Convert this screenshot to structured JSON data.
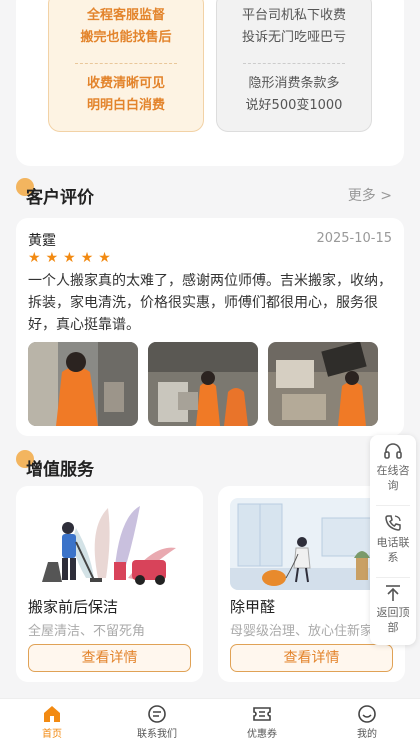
{
  "compare": {
    "good_1": "全程客服监督",
    "good_2": "搬完也能找售后",
    "good_3": "收费清晰可见",
    "good_4": "明明白白消费",
    "bad_1": "平台司机私下收费",
    "bad_2": "投诉无门吃哑巴亏",
    "bad_3": "隐形消费条款多",
    "bad_4": "说好500变1000"
  },
  "reviews_section": {
    "title": "客户评价",
    "more": "更多 >"
  },
  "review": {
    "name": "黄霆",
    "date": "2025-10-15",
    "rating": 5,
    "text": "一个人搬家真的太难了，感谢两位师傅。吉米搬家，收纳，拆装，家电清洗，价格很实惠，师傅们都很用心，服务很好，真心挺靠谱。"
  },
  "services_section": {
    "title": "增值服务"
  },
  "services": [
    {
      "title": "搬家前后保洁",
      "sub": "全屋清洁、不留死角",
      "button": "查看详情"
    },
    {
      "title": "除甲醛",
      "sub": "母婴级治理、放心住新家",
      "button": "查看详情"
    }
  ],
  "float_tools": {
    "consult_1": "在线咨",
    "consult_2": "询",
    "phone_1": "电话联",
    "phone_2": "系",
    "top_1": "返回顶",
    "top_2": "部"
  },
  "tabbar": {
    "home": "首页",
    "contact": "联系我们",
    "coupon": "优惠券",
    "mine": "我的"
  },
  "colors": {
    "accent": "#f28a12",
    "accent_bg": "#fdf3e3"
  }
}
